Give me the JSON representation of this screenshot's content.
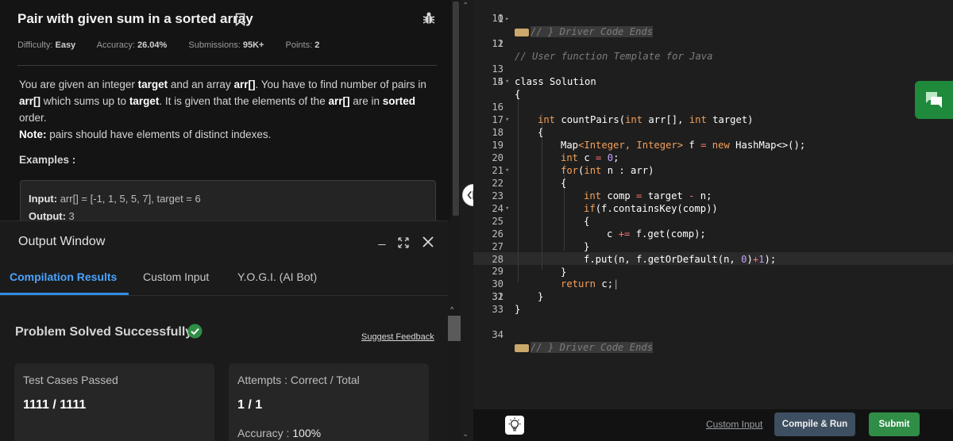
{
  "problem": {
    "title": "Pair with given sum in a sorted array",
    "meta": {
      "difficulty_label": "Difficulty:",
      "difficulty_value": "Easy",
      "accuracy_label": "Accuracy:",
      "accuracy_value": "26.04%",
      "submissions_label": "Submissions:",
      "submissions_value": "95K+",
      "points_label": "Points:",
      "points_value": "2"
    },
    "description": {
      "p1": "You are given an integer ",
      "b1": "target",
      "p2": " and an array ",
      "b2": "arr[]",
      "p3": ". You have to find number of pairs in ",
      "b3": "arr[]",
      "p4": " which sums up to ",
      "b4": "target",
      "p5": ". It is given that the elements of the ",
      "b5": "arr[]",
      "p6": " are in ",
      "b6": "sorted",
      "p7": " order.",
      "note_label": "Note:",
      "note_text": " pairs should have elements of distinct indexes."
    },
    "examples_title": "Examples :",
    "example": {
      "input_label": "Input:",
      "input_value": " arr[] = [-1, 1, 5, 5, 7], target = 6",
      "output_label": "Output:",
      "output_value": " 3"
    }
  },
  "output_window": {
    "title": "Output Window",
    "tabs": [
      "Compilation Results",
      "Custom Input",
      "Y.O.G.I. (AI Bot)"
    ],
    "result_title": "Problem Solved Successfully",
    "suggest_feedback": "Suggest Feedback",
    "tests_label": "Test Cases Passed",
    "tests_value": "1111 / 1111",
    "attempts_label": "Attempts : Correct / Total",
    "attempts_value": "1 / 1",
    "accuracy_label": "Accuracy : ",
    "accuracy_value": "100%"
  },
  "editor": {
    "line_numbers": [
      "1",
      "10",
      "11",
      "12",
      "13",
      "14",
      "15",
      "16",
      "17",
      "18",
      "19",
      "20",
      "21",
      "22",
      "23",
      "24",
      "25",
      "26",
      "27",
      "28",
      "29",
      "30",
      "31",
      "32",
      "33",
      "34"
    ],
    "comment_driver_ends": "// } Driver Code Ends",
    "comment_template": "// User function Template for Java",
    "class_decl": "class Solution",
    "open_brace": "{",
    "close_brace": "}",
    "fn_int": "int",
    "fn_rest": " countPairs(",
    "fn_int2": "int",
    "fn_arr": " arr[], ",
    "fn_int3": "int",
    "fn_target": " target)",
    "map_line": [
      "Map",
      "<Integer, Integer>",
      " f ",
      "=",
      " ",
      "new",
      " HashMap<>();"
    ],
    "int_c_line": [
      "int",
      " c ",
      "=",
      " ",
      "0",
      ";"
    ],
    "for_line": [
      "for",
      "(",
      "int",
      " n : arr)"
    ],
    "comp_line": [
      "int",
      " comp ",
      "=",
      " target ",
      "-",
      " n;"
    ],
    "if_line": [
      "if",
      "(f.containsKey(comp))"
    ],
    "c_inc_line": [
      "c ",
      "+=",
      " f.get(comp);"
    ],
    "put_line": [
      "f.put(n, f.getOrDefault(n, ",
      "0",
      ")",
      "+",
      "1",
      ");"
    ],
    "return_line": [
      "return",
      " c;"
    ]
  },
  "bottom_bar": {
    "custom_input": "Custom Input",
    "compile_run": "Compile & Run",
    "submit": "Submit"
  },
  "colors": {
    "accent_blue": "#2f8de4",
    "success_green": "#2f8d46",
    "compile_button": "#3d4f60"
  },
  "icons": [
    "bookmark-icon",
    "bug-icon",
    "minimize-icon",
    "expand-icon",
    "close-icon",
    "check-circle-icon",
    "chat-icon",
    "lightbulb-icon",
    "resize-handle-icon"
  ]
}
